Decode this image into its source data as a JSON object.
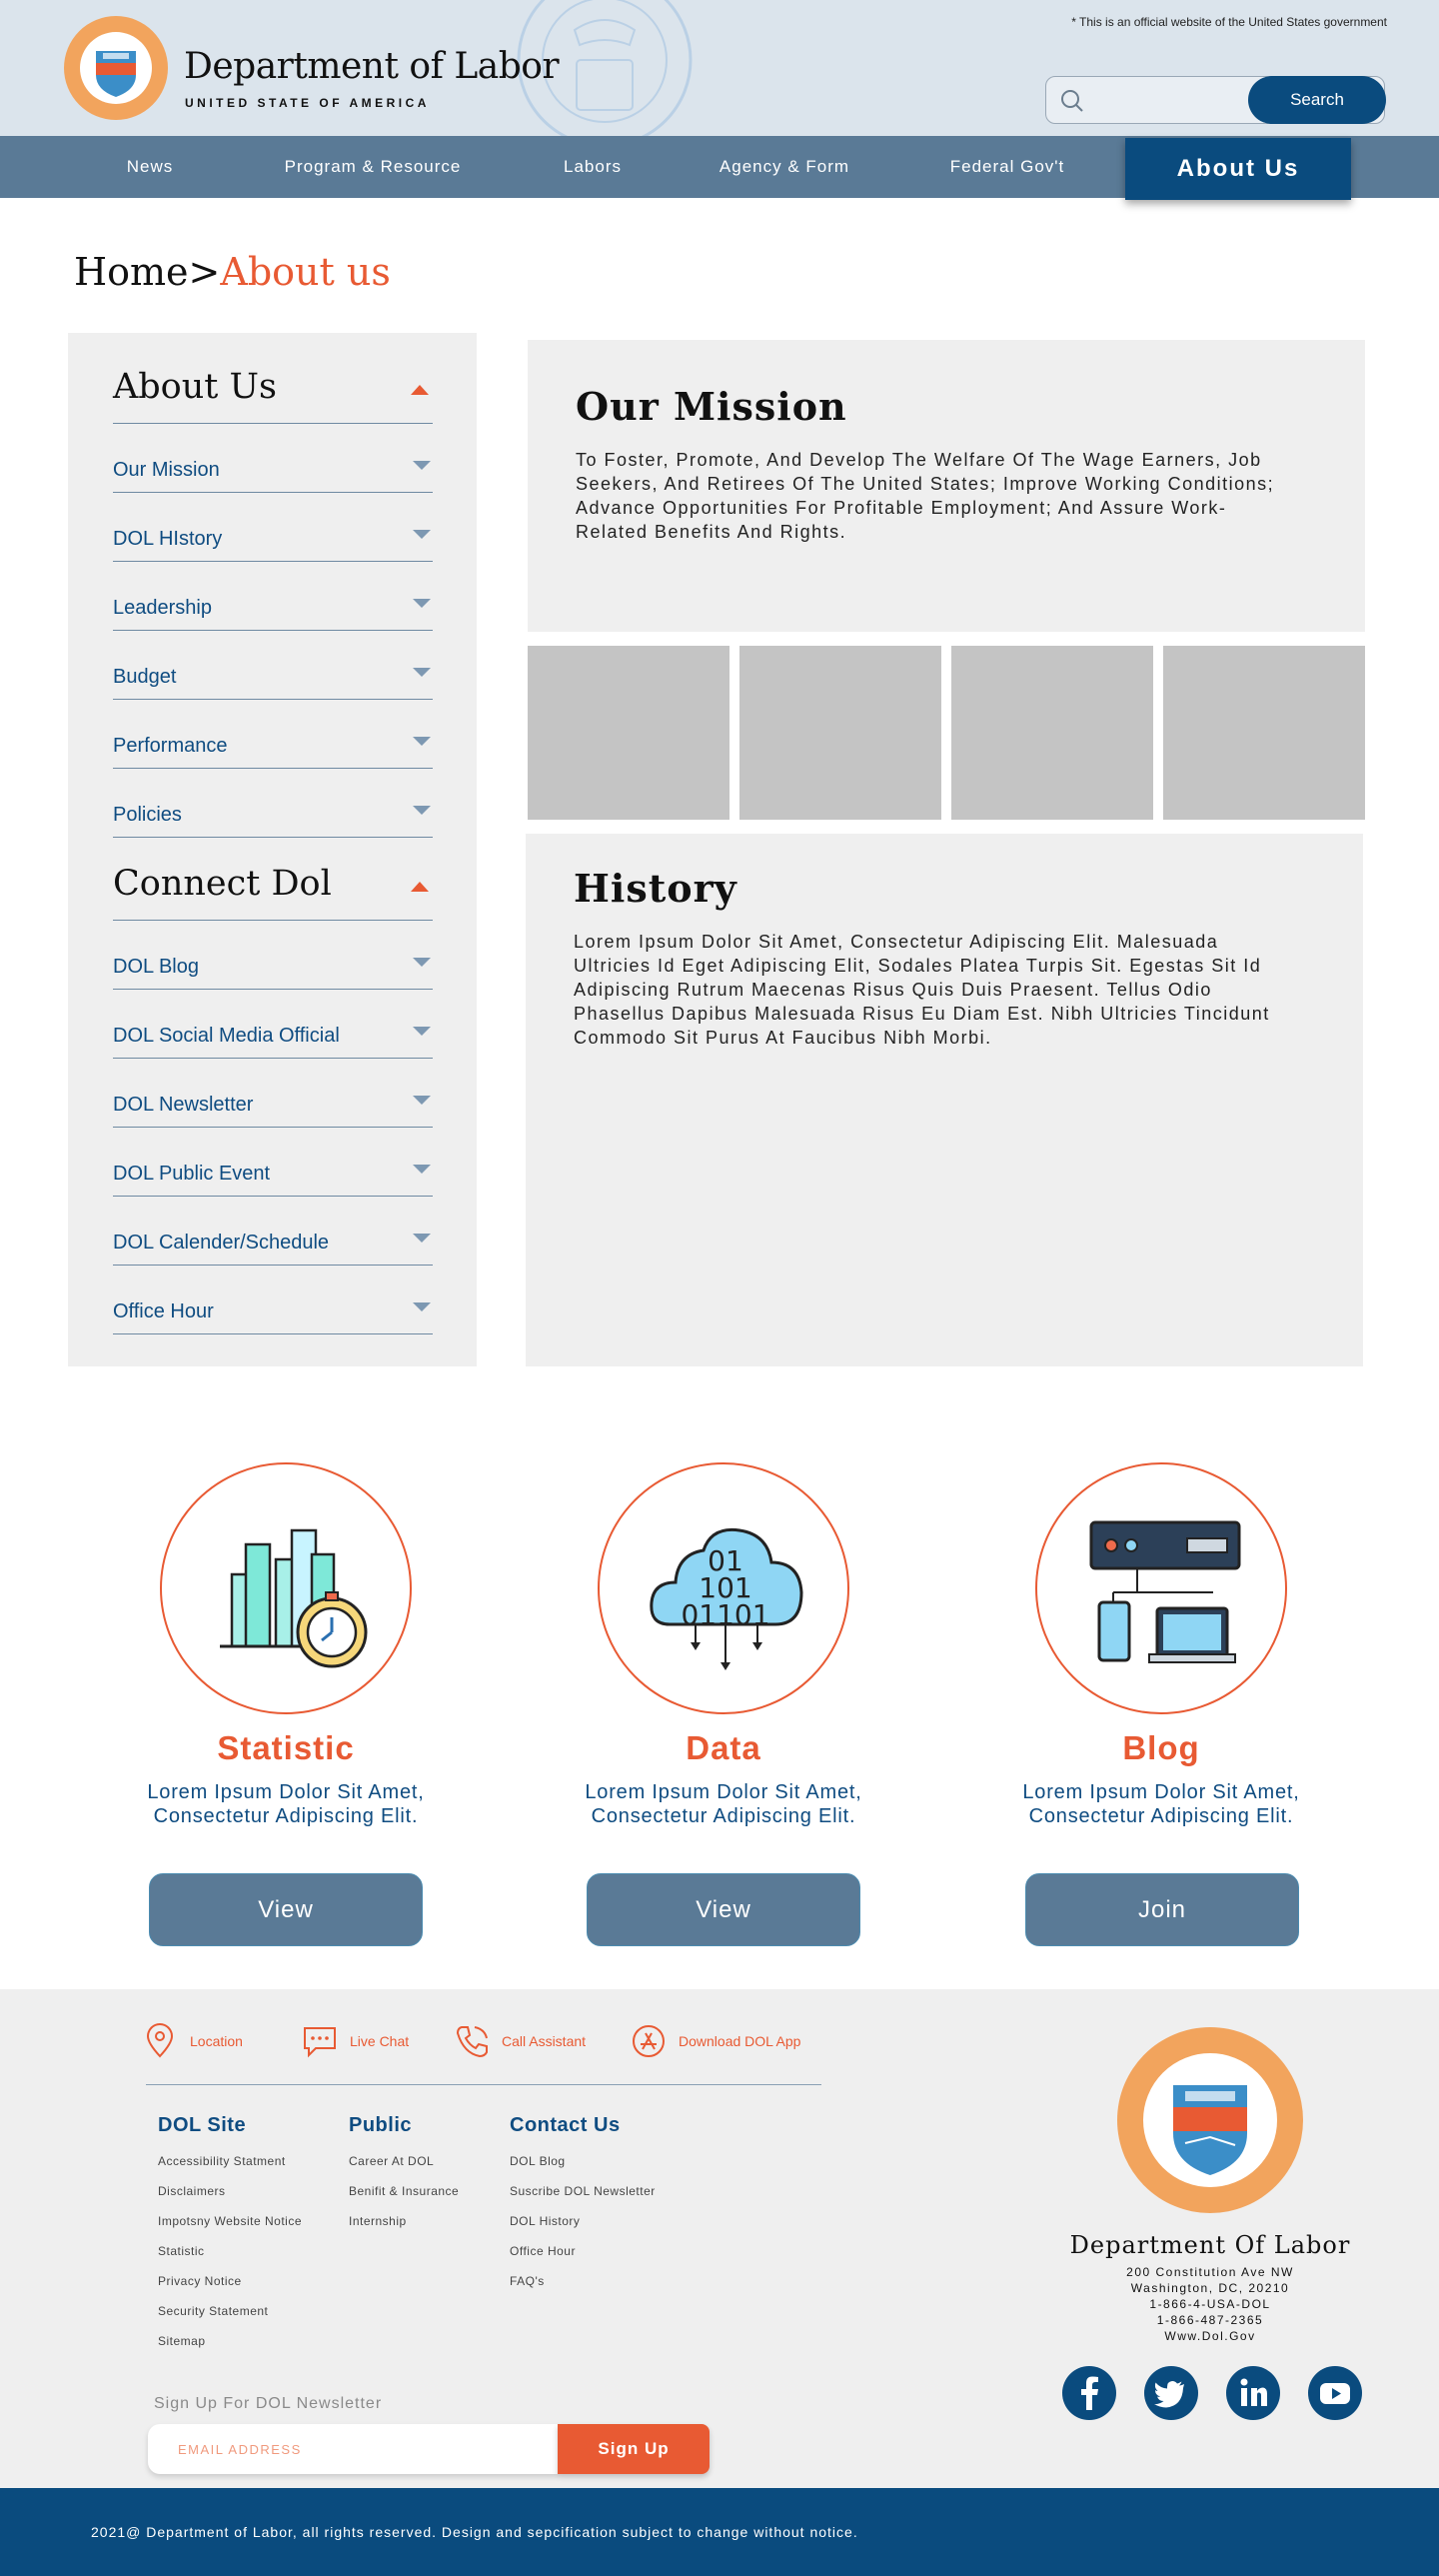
{
  "header": {
    "gov_notice": "* This is an official website of the United States government",
    "title": "Department of Labor",
    "subtitle": "UNITED STATE OF AMERICA",
    "search_placeholder": "",
    "search_button": "Search"
  },
  "nav": {
    "items": [
      "News",
      "Program & Resource",
      "Labors",
      "Agency & Form",
      "Federal Gov't"
    ],
    "active": "About Us"
  },
  "breadcrumb": {
    "home": "Home>",
    "current": "About us"
  },
  "sidebar": {
    "about_heading": "About Us",
    "about_items": [
      "Our Mission",
      "DOL HIstory",
      "Leadership",
      "Budget",
      "Performance",
      "Policies"
    ],
    "connect_heading": "Connect Dol",
    "connect_items": [
      "DOL Blog",
      "DOL Social Media Official",
      "DOL Newsletter",
      "DOL Public Event",
      "DOL Calender/Schedule",
      "Office Hour"
    ]
  },
  "mission": {
    "title": "Our Mission",
    "text": "To Foster, Promote, And Develop The Welfare Of The Wage Earners, Job Seekers, And Retirees Of The United States; Improve Working Conditions; Advance Opportunities For Profitable Employment; And Assure Work-Related Benefits And Rights."
  },
  "history": {
    "title": "History",
    "text": "Lorem Ipsum Dolor Sit Amet, Consectetur Adipiscing Elit. Malesuada Ultricies Id Eget Adipiscing Elit, Sodales Platea Turpis Sit. Egestas Sit Id Adipiscing Rutrum Maecenas Risus Quis Duis Praesent. Tellus Odio Phasellus Dapibus Malesuada Risus Eu Diam Est. Nibh Ultricies Tincidunt Commodo Sit Purus At Faucibus Nibh Morbi."
  },
  "features": [
    {
      "title": "Statistic",
      "desc": "Lorem Ipsum Dolor Sit Amet, Consectetur Adipiscing Elit.",
      "button": "View",
      "icon": "bar-chart-clock-icon"
    },
    {
      "title": "Data",
      "desc": "Lorem Ipsum Dolor Sit Amet, Consectetur Adipiscing Elit.",
      "button": "View",
      "icon": "cloud-binary-icon"
    },
    {
      "title": "Blog",
      "desc": "Lorem Ipsum Dolor Sit Amet, Consectetur Adipiscing Elit.",
      "button": "Join",
      "icon": "server-devices-icon"
    }
  ],
  "footer": {
    "quick_links": [
      {
        "label": "Location",
        "icon": "location-pin-icon"
      },
      {
        "label": "Live Chat",
        "icon": "chat-bubble-icon"
      },
      {
        "label": "Call Assistant",
        "icon": "phone-icon"
      },
      {
        "label": "Download DOL App",
        "icon": "app-store-icon"
      }
    ],
    "columns": [
      {
        "title": "DOL Site",
        "links": [
          "Accessibility Statment",
          "Disclaimers",
          "Impotsny Website Notice",
          "Statistic",
          "Privacy Notice",
          "Security Statement",
          "Sitemap"
        ]
      },
      {
        "title": "Public",
        "links": [
          "Career At DOL",
          "Benifit & Insurance",
          "Internship"
        ]
      },
      {
        "title": "Contact Us",
        "links": [
          "DOL Blog",
          "Suscribe DOL Newsletter",
          "DOL History",
          "Office Hour",
          "FAQ's"
        ]
      }
    ],
    "newsletter_label": "Sign Up For DOL Newsletter",
    "newsletter_placeholder": "EMAIL ADDRESS",
    "signup_button": "Sign Up",
    "org_name": "Department Of Labor",
    "address_lines": [
      "200 Constitution Ave NW",
      "Washington, DC, 20210",
      "1-866-4-USA-DOL",
      "1-866-487-2365",
      "Www.Dol.Gov"
    ],
    "social": [
      "facebook-icon",
      "twitter-icon",
      "linkedin-icon",
      "youtube-icon"
    ],
    "copyright": "2021@ Department of Labor, all rights reserved.  Design and sepcification subject to change without notice."
  },
  "colors": {
    "navy": "#0a4b7e",
    "slate": "#5a7a96",
    "orange": "#e85a33",
    "panel": "#efefef",
    "header_bg": "#dbe4ec"
  }
}
